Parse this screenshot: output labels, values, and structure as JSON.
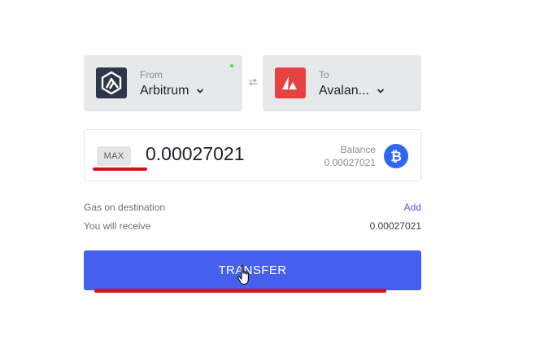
{
  "bridge": {
    "from": {
      "caption": "From",
      "chain": "Arbitrum",
      "logo_icon": "arbitrum-logo",
      "status_color": "#3ddc57"
    },
    "to": {
      "caption": "To",
      "chain": "Avalan...",
      "logo_icon": "avalanche-logo"
    },
    "swap_icon": "swap-arrows-icon"
  },
  "amount": {
    "max_label": "MAX",
    "value": "0.00027021",
    "balance_label": "Balance",
    "balance_value": "0.00027021",
    "token_icon": "bitcoin-icon"
  },
  "details": {
    "gas_label": "Gas on destination",
    "gas_action": "Add",
    "receive_label": "You will receive",
    "receive_value": "0.00027021"
  },
  "transfer": {
    "label": "TRANSFER"
  },
  "colors": {
    "accent": "#4560ef",
    "annotation": "#d0141a",
    "link": "#4a60e8"
  }
}
